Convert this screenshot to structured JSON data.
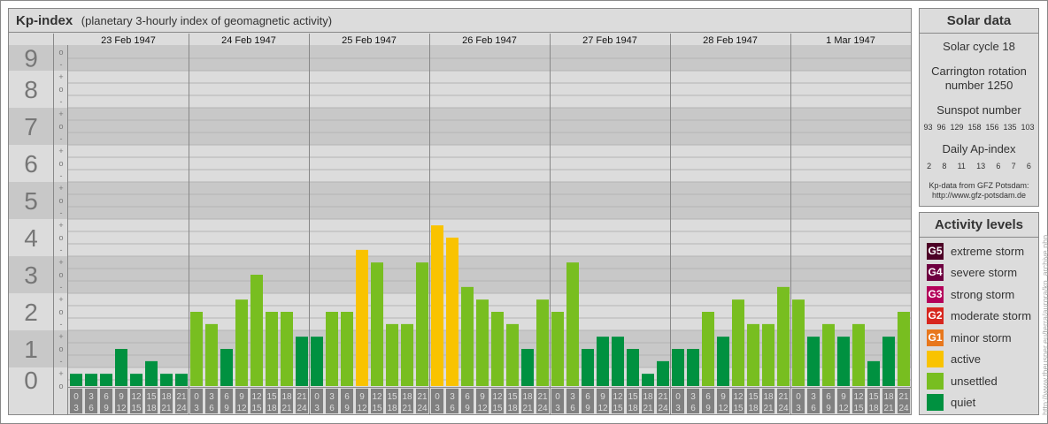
{
  "header": {
    "title": "Kp-index",
    "subtitle": "(planetary 3-hourly index of geomagnetic activity)"
  },
  "solar": {
    "title": "Solar data",
    "cycle": "Solar cycle 18",
    "carrington_1": "Carrington rotation",
    "carrington_2": "number 1250",
    "sunspot_label": "Sunspot number",
    "sunspots": [
      "93",
      "96",
      "129",
      "158",
      "156",
      "135",
      "103"
    ],
    "ap_label": "Daily Ap-index",
    "ap": [
      "2",
      "8",
      "11",
      "13",
      "6",
      "7",
      "6"
    ],
    "credit_1": "Kp-data from GFZ Potsdam:",
    "credit_2": "http://www.gfz-potsdam.de"
  },
  "activity": {
    "title": "Activity levels",
    "levels": [
      {
        "badge": "G5",
        "label": "extreme storm",
        "color": "#4d0026"
      },
      {
        "badge": "G4",
        "label": "severe storm",
        "color": "#6e0040"
      },
      {
        "badge": "G3",
        "label": "strong storm",
        "color": "#b4005a"
      },
      {
        "badge": "G2",
        "label": "moderate storm",
        "color": "#d7261e"
      },
      {
        "badge": "G1",
        "label": "minor storm",
        "color": "#e8771c"
      },
      {
        "badge": "",
        "label": "active",
        "color": "#f9c300"
      },
      {
        "badge": "",
        "label": "unsettled",
        "color": "#78be20"
      },
      {
        "badge": "",
        "label": "quiet",
        "color": "#009140"
      }
    ]
  },
  "watermark": "http://www.theusner.eu/terra/aurora/kp_archive.php",
  "chart_data": {
    "type": "bar",
    "title": "Kp-index",
    "ylim": [
      0,
      9
    ],
    "yticks": [
      "0",
      "1",
      "2",
      "3",
      "4",
      "5",
      "6",
      "7",
      "8",
      "9"
    ],
    "subticks": [
      "-",
      "o",
      "+"
    ],
    "days": [
      "23 Feb 1947",
      "24 Feb 1947",
      "25 Feb 1947",
      "26 Feb 1947",
      "27 Feb 1947",
      "28 Feb 1947",
      "1 Mar 1947"
    ],
    "intervals": [
      [
        "0",
        "3"
      ],
      [
        "3",
        "6"
      ],
      [
        "6",
        "9"
      ],
      [
        "9",
        "12"
      ],
      [
        "12",
        "15"
      ],
      [
        "15",
        "18"
      ],
      [
        "18",
        "21"
      ],
      [
        "21",
        "24"
      ]
    ],
    "values": [
      [
        0.33,
        0.33,
        0.33,
        1.0,
        0.33,
        0.67,
        0.33,
        0.33
      ],
      [
        2.0,
        1.67,
        1.0,
        2.33,
        3.0,
        2.0,
        2.0,
        1.33
      ],
      [
        1.33,
        2.0,
        2.0,
        3.67,
        3.33,
        1.67,
        1.67,
        3.33
      ],
      [
        4.33,
        4.0,
        2.67,
        2.33,
        2.0,
        1.67,
        1.0,
        2.33
      ],
      [
        2.0,
        3.33,
        1.0,
        1.33,
        1.33,
        1.0,
        0.33,
        0.67
      ],
      [
        1.0,
        1.0,
        2.0,
        1.33,
        2.33,
        1.67,
        1.67,
        2.67
      ],
      [
        2.33,
        1.33,
        1.67,
        1.33,
        1.67,
        0.67,
        1.33,
        2.0
      ]
    ],
    "colors": {
      "quiet": "#009140",
      "unsettled": "#78be20",
      "active": "#f9c300"
    }
  }
}
